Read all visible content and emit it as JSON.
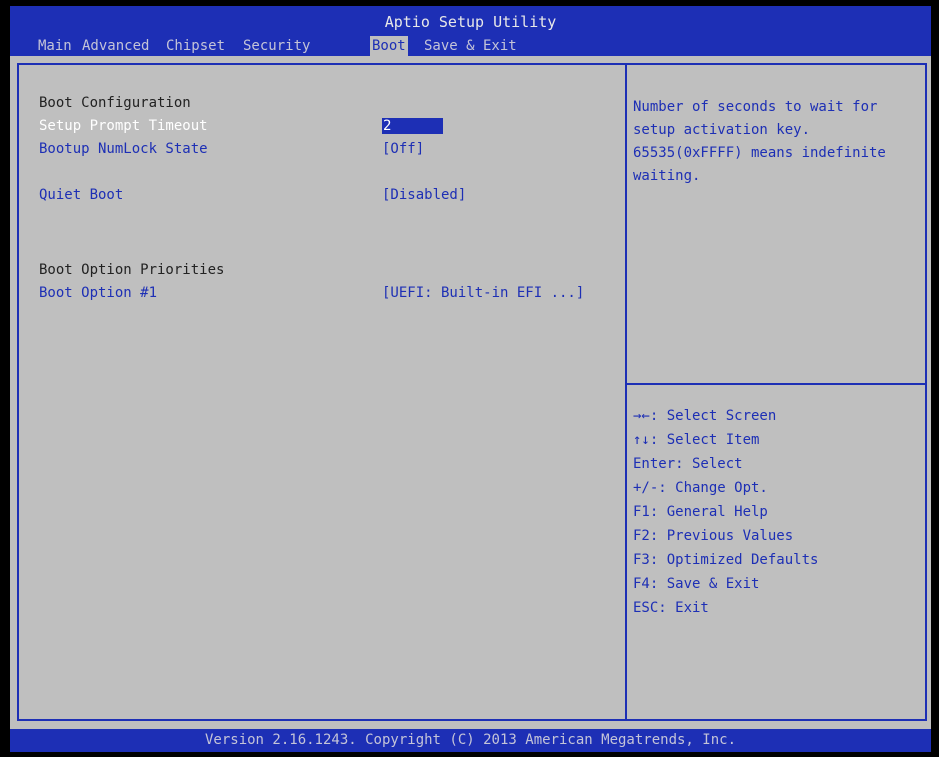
{
  "header": {
    "title": "Aptio Setup Utility",
    "tabs": [
      {
        "label": "Main"
      },
      {
        "label": "Advanced"
      },
      {
        "label": "Chipset"
      },
      {
        "label": "Security"
      },
      {
        "label": "Boot",
        "active": true
      },
      {
        "label": "Save & Exit"
      }
    ]
  },
  "left_panel": {
    "section1_heading": "Boot Configuration",
    "setup_prompt_timeout": {
      "label": "Setup Prompt Timeout",
      "value": "2"
    },
    "bootup_numlock_state": {
      "label": "Bootup NumLock State",
      "value": "[Off]"
    },
    "quiet_boot": {
      "label": "Quiet Boot",
      "value": "[Disabled]"
    },
    "section2_heading": "Boot Option Priorities",
    "boot_option_1": {
      "label": "Boot Option #1",
      "value": "[UEFI: Built-in EFI ...]"
    }
  },
  "help_panel": {
    "lines": [
      "Number of seconds to wait for",
      "setup activation key.",
      "65535(0xFFFF) means indefinite",
      "waiting."
    ]
  },
  "key_help": {
    "lines": [
      "→←: Select Screen",
      "↑↓: Select Item",
      "Enter: Select",
      "+/-: Change Opt.",
      "F1: General Help",
      "F2: Previous Values",
      "F3: Optimized Defaults",
      "F4: Save & Exit",
      "ESC: Exit"
    ]
  },
  "footer": {
    "text": "Version 2.16.1243. Copyright (C) 2013 American Megatrends, Inc."
  },
  "colors": {
    "accent_blue": "#1d2fb5",
    "background_gray": "#bfbfbf"
  }
}
